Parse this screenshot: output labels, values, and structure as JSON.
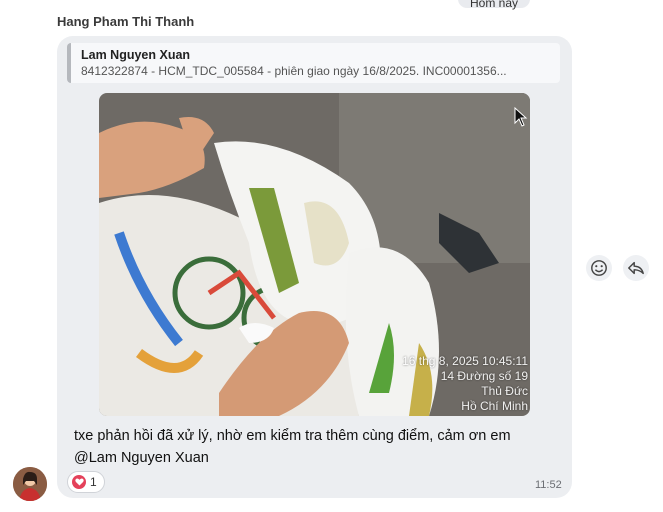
{
  "header": {
    "today_label": "Hôm nay"
  },
  "message": {
    "sender": "Hang Pham Thi Thanh",
    "quote": {
      "author": "Lam Nguyen Xuan",
      "text": "8412322874 - HCM_TDC_005584 - phiên giao ngày 16/8/2025. INC00001356..."
    },
    "photo": {
      "stamp_line1": "16 thg 8, 2025 10:45:11",
      "stamp_line2": "14 Đường số 19",
      "stamp_line3": "Thủ Đức",
      "stamp_line4": "Hồ Chí Minh"
    },
    "text": "txe phản hồi đã xử lý, nhờ em kiểm tra thêm cùng điểm, cảm ơn em @Lam Nguyen Xuan",
    "reaction": {
      "icon": "heart-icon",
      "count": "1"
    },
    "time": "11:52"
  },
  "actions": {
    "emoji_icon": "smile-icon",
    "reply_icon": "reply-icon"
  },
  "colors": {
    "bubble": "#eceef1",
    "reaction_heart": "#e4415a"
  }
}
